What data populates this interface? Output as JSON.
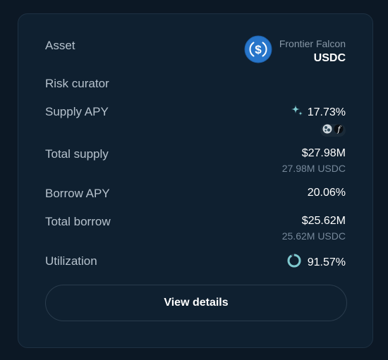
{
  "card": {
    "asset": {
      "label": "Asset",
      "vault_name": "Frontier Falcon",
      "symbol": "USDC",
      "icon": "usdc-token-icon"
    },
    "risk_curator": {
      "label": "Risk curator"
    },
    "supply_apy": {
      "label": "Supply APY",
      "value": "17.73%",
      "icon": "sparkle-icon",
      "reward_icons": [
        "reward-token-icon",
        "f-token-icon"
      ]
    },
    "total_supply": {
      "label": "Total supply",
      "value": "$27.98M",
      "sub": "27.98M USDC"
    },
    "borrow_apy": {
      "label": "Borrow APY",
      "value": "20.06%"
    },
    "total_borrow": {
      "label": "Total borrow",
      "value": "$25.62M",
      "sub": "25.62M USDC"
    },
    "utilization": {
      "label": "Utilization",
      "value": "91.57%",
      "fraction": 0.9157
    },
    "button": {
      "label": "View details"
    }
  },
  "colors": {
    "background": "#0c1825",
    "card": "#0f2030",
    "usdc_blue": "#2775ca",
    "sparkle": "#7fc9cf",
    "ring": "#7fc9cf"
  }
}
